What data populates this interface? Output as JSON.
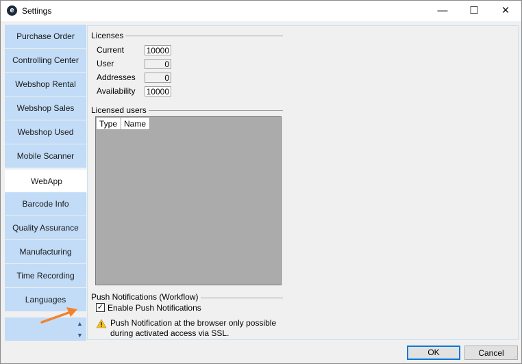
{
  "window": {
    "title": "Settings",
    "app_icon_letter": "e"
  },
  "titlebar": {
    "min_glyph": "—",
    "max_glyph": "☐",
    "close_glyph": "✕"
  },
  "sidebar": {
    "items": [
      {
        "label": "Purchase Order"
      },
      {
        "label": "Controlling Center"
      },
      {
        "label": "Webshop Rental"
      },
      {
        "label": "Webshop Sales"
      },
      {
        "label": "Webshop Used"
      },
      {
        "label": "Mobile Scanner"
      },
      {
        "label": "WebApp"
      },
      {
        "label": "Barcode Info"
      },
      {
        "label": "Quality Assurance"
      },
      {
        "label": "Manufacturing"
      },
      {
        "label": "Time Recording"
      },
      {
        "label": "Languages"
      }
    ],
    "active_item": "WebApp"
  },
  "licenses": {
    "title": "Licenses",
    "current_label": "Current",
    "current_value": "10000",
    "user_label": "User",
    "user_value": "0",
    "addresses_label": "Addresses",
    "addresses_value": "0",
    "availability_label": "Availability",
    "availability_value": "10000"
  },
  "licensed_users": {
    "title": "Licensed users",
    "columns": [
      "Type",
      "Name"
    ]
  },
  "push": {
    "title": "Push Notifications (Workflow)",
    "enable_label": "Enable Push Notifications",
    "enabled": true,
    "warning_text": "Push Notification at the browser only possible during activated access via SSL."
  },
  "buttons": {
    "ok": "OK",
    "cancel": "Cancel"
  },
  "colors": {
    "sidebar_tab": "#c2dcf7",
    "ok_border": "#0078d7",
    "arrow": "#f5822a",
    "grid_bg": "#ababab"
  }
}
